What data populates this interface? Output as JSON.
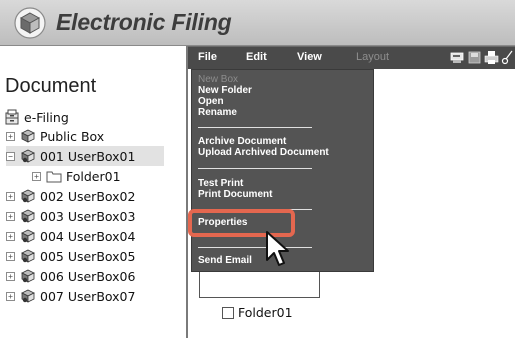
{
  "app": {
    "title": "Electronic Filing"
  },
  "menubar": {
    "items": [
      "File",
      "Edit",
      "View",
      "Layout"
    ]
  },
  "left_panel": {
    "section_title": "Document",
    "root": "e-Filing",
    "tree": [
      {
        "label": "Public Box"
      },
      {
        "label": "001 UserBox01"
      },
      {
        "label": "Folder01"
      },
      {
        "label": "002 UserBox02"
      },
      {
        "label": "003 UserBox03"
      },
      {
        "label": "004 UserBox04"
      },
      {
        "label": "005 UserBox05"
      },
      {
        "label": "006 UserBox06"
      },
      {
        "label": "007 UserBox07"
      }
    ]
  },
  "content": {
    "folder_label": "Folder01"
  },
  "file_menu": {
    "items": [
      {
        "label": "New Box",
        "enabled": false
      },
      {
        "label": "New Folder",
        "enabled": true
      },
      {
        "label": "Open",
        "enabled": true
      },
      {
        "label": "Rename",
        "enabled": true
      },
      {
        "label": "Archive Document",
        "enabled": true
      },
      {
        "label": "Upload Archived Document",
        "enabled": true
      },
      {
        "label": "Test Print",
        "enabled": true
      },
      {
        "label": "Print Document",
        "enabled": true
      },
      {
        "label": "Properties",
        "enabled": true
      },
      {
        "label": "Send Email",
        "enabled": true
      }
    ]
  },
  "colors": {
    "highlight": "#e4674f",
    "menubar": "#4a4a4a",
    "dropdown": "#545454"
  }
}
